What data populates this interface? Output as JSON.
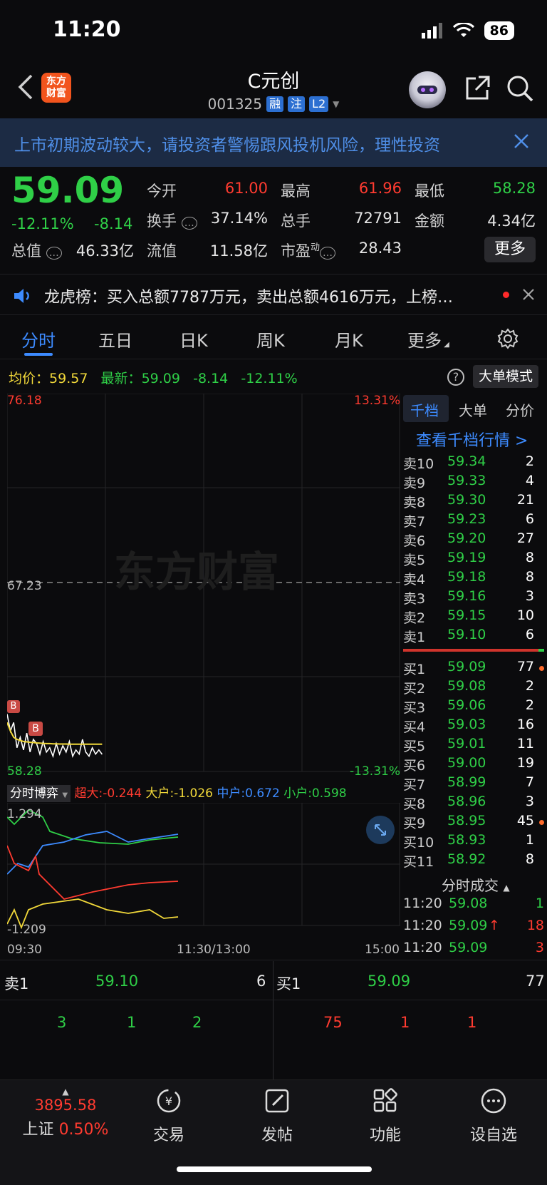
{
  "status": {
    "time": "11:20",
    "battery": "86"
  },
  "header": {
    "logo_line1": "东方",
    "logo_line2": "财富",
    "name": "C元创",
    "code": "001325",
    "tags": [
      "融",
      "注",
      "L2"
    ]
  },
  "notice": {
    "text": "上市初期波动较大，请投资者警惕跟风投机风险，理性投资"
  },
  "quote": {
    "price": "59.09",
    "pct": "-12.11%",
    "change": "-8.14",
    "open_label": "今开",
    "open": "61.00",
    "high_label": "最高",
    "high": "61.96",
    "low_label": "最低",
    "low": "58.28",
    "turnover_label": "换手",
    "turnover": "37.14%",
    "volume_label": "总手",
    "volume": "72791",
    "amount_label": "金额",
    "amount": "4.34亿",
    "mktcap_label": "总值",
    "mktcap": "46.33亿",
    "float_label": "流值",
    "float": "11.58亿",
    "pe_label": "市盈",
    "pe_sup": "动",
    "pe": "28.43",
    "more": "更多"
  },
  "lhb": {
    "text": "龙虎榜：买入总额7787万元，卖出总额4616万元，上榜…"
  },
  "tabs": [
    "分时",
    "五日",
    "日K",
    "周K",
    "月K",
    "更多"
  ],
  "info": {
    "avg_label": "均价：",
    "avg": "59.57",
    "last_label": "最新：",
    "last": "59.09",
    "chg": "-8.14",
    "pct": "-12.11%",
    "mode": "大单模式"
  },
  "chart": {
    "y_top": "76.18",
    "y_mid": "67.23",
    "y_bot": "58.28",
    "pct_top": "13.31%",
    "pct_bot": "-13.31%",
    "watermark": "东方财富",
    "flow_title": "分时博弈",
    "flow_super": "超大:-0.244",
    "flow_large": "大户:-1.026",
    "flow_mid": "中户:0.672",
    "flow_small": "小户:0.598",
    "flow_top": "1.294",
    "flow_bot": "-1.209",
    "x_start": "09:30",
    "x_mid": "11:30/13:00",
    "x_end": "15:00",
    "b_marker": "B"
  },
  "chart_data": {
    "type": "line",
    "title": "",
    "xlabel": "",
    "ylabel": "",
    "x_ticks": [
      "09:30",
      "11:30/13:00",
      "15:00"
    ],
    "ylim": [
      58.28,
      76.18
    ],
    "series": [
      {
        "values": [
          61.0,
          60.2,
          60.6,
          59.4,
          59.9,
          59.3,
          60.1,
          59.2,
          59.8,
          59.6,
          59.1,
          59.7,
          59.2,
          59.4,
          59.0,
          59.6,
          59.1,
          59.5,
          59.2,
          59.7,
          59.0,
          59.3,
          59.1,
          59.8,
          59.2,
          59.0,
          59.4,
          59.1,
          59.3,
          59.09
        ]
      },
      {
        "values": [
          60.6,
          60.2,
          59.9,
          59.8,
          59.75,
          59.7,
          59.68,
          59.66,
          59.65,
          59.63,
          59.62,
          59.61,
          59.6,
          59.6,
          59.59,
          59.59,
          59.58,
          59.58,
          59.58,
          59.57,
          59.57,
          59.57,
          59.57,
          59.57,
          59.57,
          59.57,
          59.57,
          59.57,
          59.57,
          59.57
        ]
      }
    ]
  },
  "order_book": {
    "tabs": [
      "千档",
      "大单",
      "分价"
    ],
    "link": "查看千档行情 >",
    "asks": [
      {
        "label": "卖10",
        "price": "59.34",
        "vol": "2",
        "dot": false
      },
      {
        "label": "卖9",
        "price": "59.33",
        "vol": "4",
        "dot": false
      },
      {
        "label": "卖8",
        "price": "59.30",
        "vol": "21",
        "dot": false
      },
      {
        "label": "卖7",
        "price": "59.23",
        "vol": "6",
        "dot": false
      },
      {
        "label": "卖6",
        "price": "59.20",
        "vol": "27",
        "dot": false
      },
      {
        "label": "卖5",
        "price": "59.19",
        "vol": "8",
        "dot": false
      },
      {
        "label": "卖4",
        "price": "59.18",
        "vol": "8",
        "dot": false
      },
      {
        "label": "卖3",
        "price": "59.16",
        "vol": "3",
        "dot": false
      },
      {
        "label": "卖2",
        "price": "59.15",
        "vol": "10",
        "dot": false
      },
      {
        "label": "卖1",
        "price": "59.10",
        "vol": "6",
        "dot": false
      }
    ],
    "bids": [
      {
        "label": "买1",
        "price": "59.09",
        "vol": "77",
        "dot": true
      },
      {
        "label": "买2",
        "price": "59.08",
        "vol": "2",
        "dot": false
      },
      {
        "label": "买3",
        "price": "59.06",
        "vol": "2",
        "dot": false
      },
      {
        "label": "买4",
        "price": "59.03",
        "vol": "16",
        "dot": false
      },
      {
        "label": "买5",
        "price": "59.01",
        "vol": "11",
        "dot": false
      },
      {
        "label": "买6",
        "price": "59.00",
        "vol": "19",
        "dot": false
      },
      {
        "label": "买7",
        "price": "58.99",
        "vol": "7",
        "dot": false
      },
      {
        "label": "买8",
        "price": "58.96",
        "vol": "3",
        "dot": false
      },
      {
        "label": "买9",
        "price": "58.95",
        "vol": "45",
        "dot": true
      },
      {
        "label": "买10",
        "price": "58.93",
        "vol": "1",
        "dot": false
      },
      {
        "label": "买11",
        "price": "58.92",
        "vol": "8",
        "dot": false
      }
    ],
    "trades_title": "分时成交",
    "trades": [
      {
        "time": "11:20",
        "price": "59.08",
        "arrow": "",
        "vol": "1",
        "vol_color": "#2fcf47"
      },
      {
        "time": "11:20",
        "price": "59.09",
        "arrow": "↑",
        "vol": "18",
        "vol_color": "#ff3b30"
      },
      {
        "time": "11:20",
        "price": "59.09",
        "arrow": "",
        "vol": "3",
        "vol_color": "#ff3b30"
      }
    ]
  },
  "summary": {
    "ask_label": "卖1",
    "ask_price": "59.10",
    "ask_vol": "6",
    "bid_label": "买1",
    "bid_price": "59.09",
    "bid_vol": "77",
    "ask_queue": [
      "3",
      "1",
      "2"
    ],
    "bid_queue": [
      "75",
      "1",
      "1"
    ]
  },
  "nav": {
    "index_value": "3895.58",
    "index_name": "上证",
    "index_pct": "0.50%",
    "trade": "交易",
    "post": "发帖",
    "func": "功能",
    "watch": "设自选"
  },
  "colors": {
    "up": "#ff3b30",
    "down": "#2fcf47",
    "accent": "#3d8bff",
    "avg_line": "#f2d93a"
  }
}
